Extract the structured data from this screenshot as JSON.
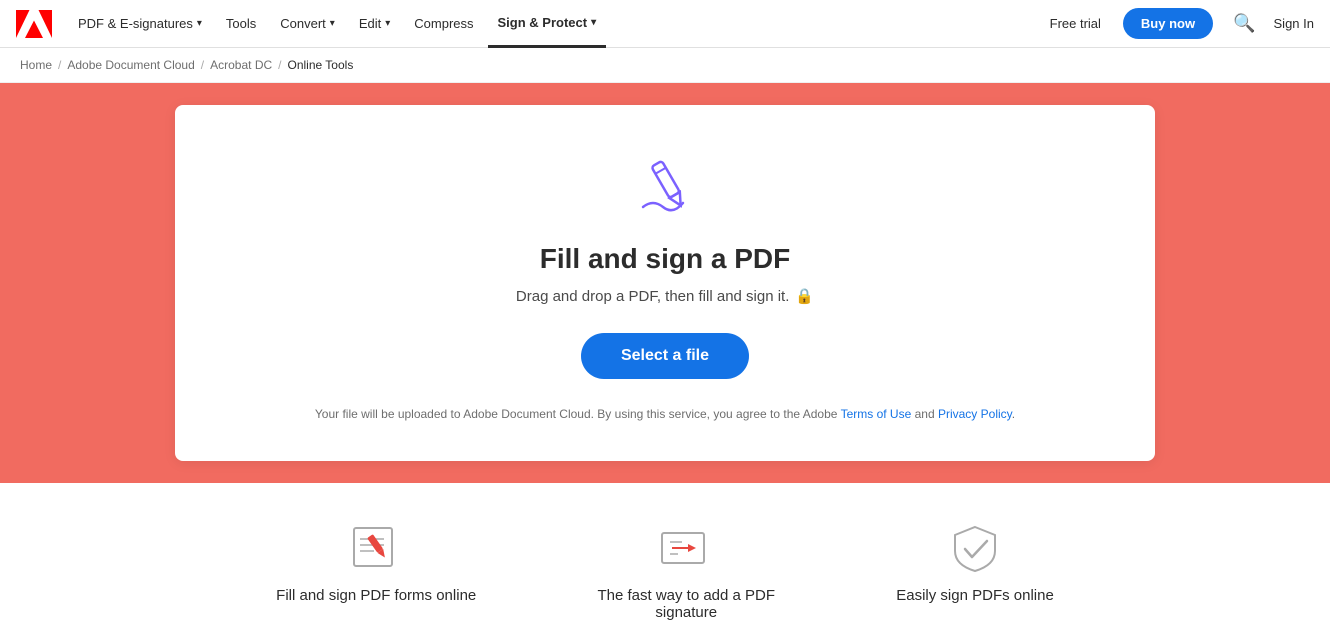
{
  "navbar": {
    "logo_text": "Adobe",
    "items": [
      {
        "label": "PDF & E-signatures",
        "has_chevron": true,
        "active": false
      },
      {
        "label": "Tools",
        "has_chevron": false,
        "active": false
      },
      {
        "label": "Convert",
        "has_chevron": true,
        "active": false
      },
      {
        "label": "Edit",
        "has_chevron": true,
        "active": false
      },
      {
        "label": "Compress",
        "has_chevron": false,
        "active": false
      },
      {
        "label": "Sign & Protect",
        "has_chevron": true,
        "active": true
      }
    ],
    "free_trial_label": "Free trial",
    "buy_now_label": "Buy now",
    "sign_in_label": "Sign In"
  },
  "breadcrumb": {
    "items": [
      {
        "label": "Home",
        "link": true
      },
      {
        "label": "Adobe Document Cloud",
        "link": true
      },
      {
        "label": "Acrobat DC",
        "link": true
      },
      {
        "label": "Online Tools",
        "link": false
      }
    ]
  },
  "hero": {
    "title": "Fill and sign a PDF",
    "subtitle": "Drag and drop a PDF, then fill and sign it.",
    "select_file_label": "Select a file",
    "legal_text": "Your file will be uploaded to Adobe Document Cloud.  By using this service, you agree to the Adobe ",
    "terms_label": "Terms of Use",
    "and_text": " and ",
    "privacy_label": "Privacy Policy",
    "legal_end": "."
  },
  "features": [
    {
      "title": "Fill and sign PDF forms online"
    },
    {
      "title": "The fast way to add a PDF signature"
    },
    {
      "title": "Easily sign PDFs online"
    }
  ],
  "colors": {
    "hero_bg": "#f16b60",
    "brand_blue": "#1473e6",
    "icon_purple": "#7B61FF"
  }
}
